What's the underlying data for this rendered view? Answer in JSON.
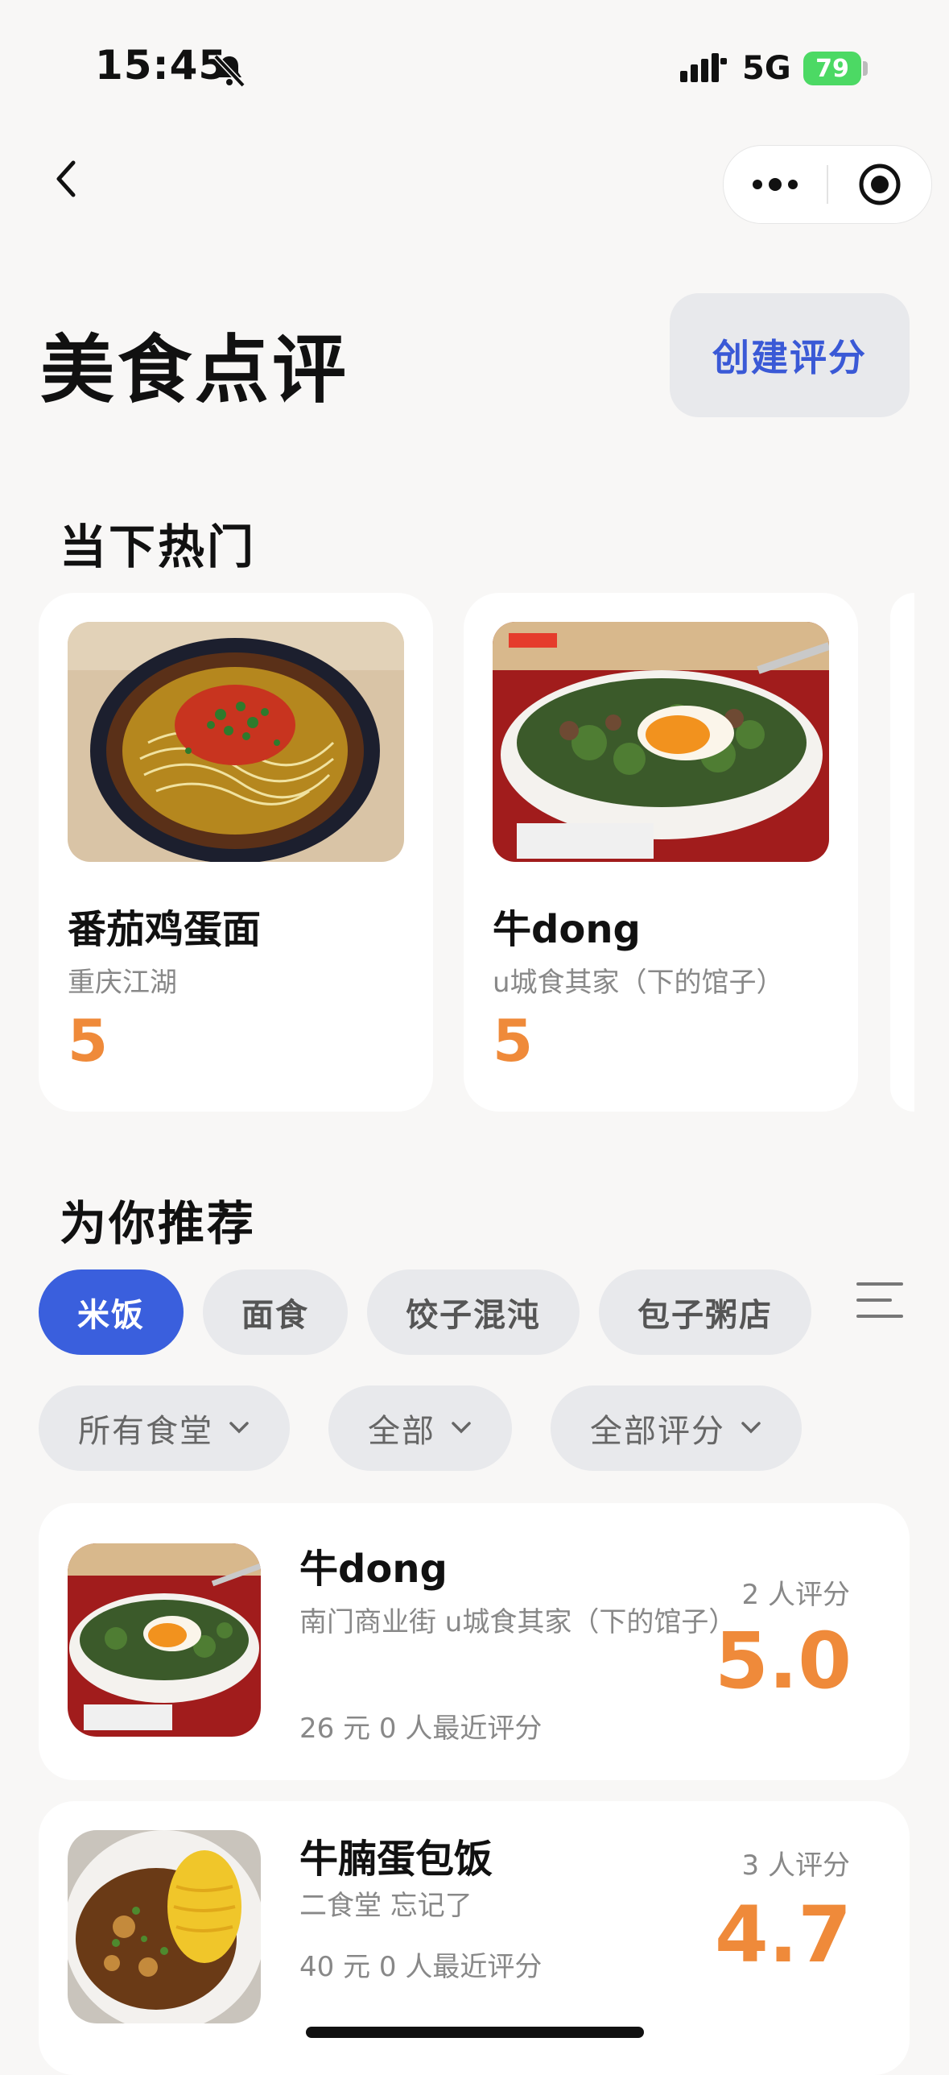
{
  "status": {
    "time": "15:45",
    "network": "5G",
    "battery": "79"
  },
  "header": {
    "title": "美食点评",
    "create_button": "创建评分"
  },
  "hot": {
    "title": "当下热门",
    "cards": [
      {
        "name": "番茄鸡蛋面",
        "place": "重庆江湖",
        "score": "5"
      },
      {
        "name": "牛dong",
        "place": "u城食其家（下的馆子）",
        "score": "5"
      }
    ]
  },
  "recommend": {
    "title": "为你推荐",
    "tabs": [
      "米饭",
      "面食",
      "饺子混沌",
      "包子粥店"
    ],
    "active_tab": "米饭",
    "filters": [
      "所有食堂",
      "全部",
      "全部评分"
    ]
  },
  "list": [
    {
      "name": "牛dong",
      "location": "南门商业街 u城食其家（下的馆子）",
      "meta": "26 元 0 人最近评分",
      "count": "2 人评分",
      "score": "5.0"
    },
    {
      "name": "牛腩蛋包饭",
      "location": "二食堂 忘记了",
      "meta": "40 元 0 人最近评分",
      "count": "3 人评分",
      "score": "4.7"
    }
  ]
}
